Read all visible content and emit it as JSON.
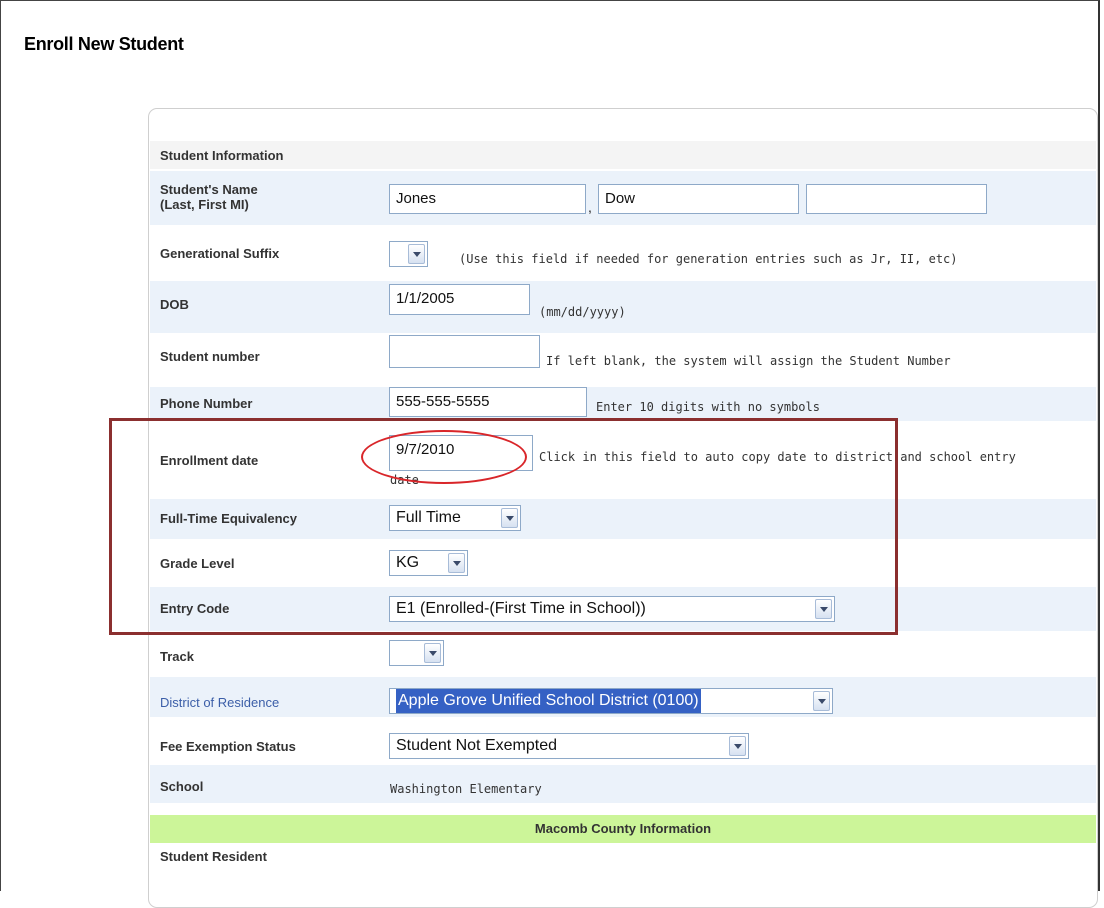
{
  "page": {
    "title": "Enroll New Student"
  },
  "form": {
    "section_label": "Student Information",
    "name": {
      "label_line1": "Student's Name",
      "label_line2": "(Last, First MI)",
      "last": "Jones",
      "separator": ",",
      "first": "Dow",
      "mi": ""
    },
    "suffix": {
      "label": "Generational Suffix",
      "value": "",
      "hint": "(Use this field if needed for generation entries such as Jr, II, etc)"
    },
    "dob": {
      "label": "DOB",
      "value": "1/1/2005",
      "hint": "(mm/dd/yyyy)"
    },
    "student_number": {
      "label": "Student number",
      "value": "",
      "hint": "If left blank, the system will assign the Student Number"
    },
    "phone": {
      "label": "Phone Number",
      "value": "555-555-5555",
      "hint": "Enter 10 digits with no symbols"
    },
    "enrollment_date": {
      "label": "Enrollment date",
      "value": "9/7/2010",
      "hint_line1": "Click in this field to auto copy date to district and school entry",
      "hint_line2": "date"
    },
    "fte": {
      "label": "Full-Time Equivalency",
      "value": "Full Time"
    },
    "grade": {
      "label": "Grade Level",
      "value": "KG"
    },
    "entry_code": {
      "label": "Entry Code",
      "value": "E1 (Enrolled-(First Time in School))"
    },
    "track": {
      "label": "Track",
      "value": ""
    },
    "district": {
      "label": "District of Residence",
      "value": "Apple Grove Unified School District (0100)"
    },
    "fee_exemption": {
      "label": "Fee Exemption Status",
      "value": "Student Not Exempted"
    },
    "school": {
      "label": "School",
      "value": "Washington Elementary"
    }
  },
  "county_section": {
    "title": "Macomb County Information",
    "first_label": "Student Resident"
  },
  "colors": {
    "row_shade": "#ebf2fa",
    "section_green": "#ccf599",
    "annotation_box": "#8b2f2f",
    "annotation_ellipse": "#d9262a",
    "selection_blue": "#3561c4"
  }
}
